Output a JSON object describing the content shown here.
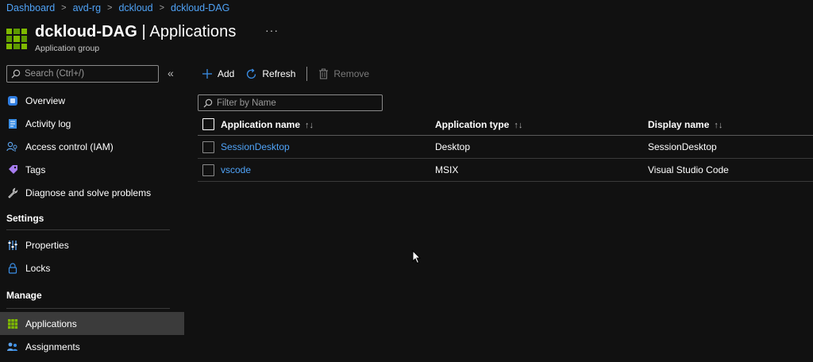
{
  "breadcrumb": [
    "Dashboard",
    "avd-rg",
    "dckloud",
    "dckloud-DAG"
  ],
  "header": {
    "title_bold": "dckloud-DAG",
    "title_rest": " | Applications",
    "subtitle": "Application group",
    "more": "···"
  },
  "sidebar": {
    "search_placeholder": "Search (Ctrl+/)",
    "collapse": "«",
    "items_top": [
      {
        "label": "Overview",
        "icon": "overview-icon"
      },
      {
        "label": "Activity log",
        "icon": "activity-log-icon"
      },
      {
        "label": "Access control (IAM)",
        "icon": "iam-icon"
      },
      {
        "label": "Tags",
        "icon": "tag-icon"
      },
      {
        "label": "Diagnose and solve problems",
        "icon": "wrench-icon"
      }
    ],
    "section_settings": "Settings",
    "items_settings": [
      {
        "label": "Properties",
        "icon": "properties-icon"
      },
      {
        "label": "Locks",
        "icon": "lock-icon"
      }
    ],
    "section_manage": "Manage",
    "items_manage": [
      {
        "label": "Applications",
        "icon": "applications-icon",
        "active": true
      },
      {
        "label": "Assignments",
        "icon": "assignments-icon"
      }
    ]
  },
  "toolbar": {
    "add": "Add",
    "refresh": "Refresh",
    "remove": "Remove"
  },
  "filter": {
    "placeholder": "Filter by Name"
  },
  "table": {
    "columns": [
      "Application name",
      "Application type",
      "Display name"
    ],
    "rows": [
      {
        "name": "SessionDesktop",
        "type": "Desktop",
        "display": "SessionDesktop"
      },
      {
        "name": "vscode",
        "type": "MSIX",
        "display": "Visual Studio Code"
      }
    ]
  },
  "colors": {
    "background": "#111111",
    "link": "#4fa3f7",
    "accent_green": "#7fba00",
    "active_nav": "#3b3b3b"
  }
}
